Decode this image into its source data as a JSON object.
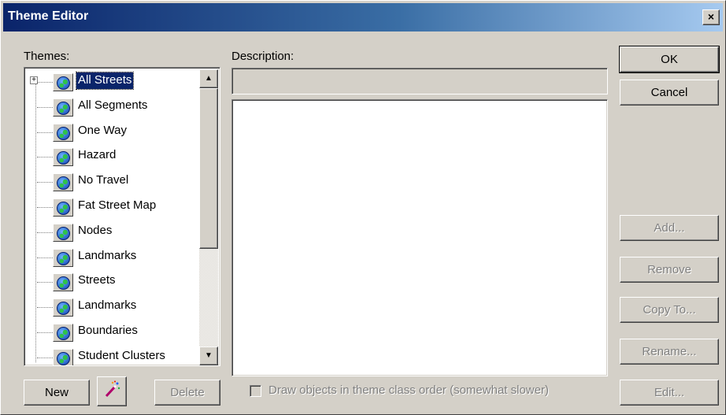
{
  "window": {
    "title": "Theme Editor",
    "close_glyph": "×"
  },
  "themes": {
    "label": "Themes:",
    "items": [
      {
        "label": "All Streets",
        "selected": true,
        "expandable": true
      },
      {
        "label": "All Segments"
      },
      {
        "label": "One Way"
      },
      {
        "label": "Hazard"
      },
      {
        "label": "No Travel"
      },
      {
        "label": "Fat Street Map"
      },
      {
        "label": "Nodes"
      },
      {
        "label": "Landmarks"
      },
      {
        "label": "Streets"
      },
      {
        "label": "Landmarks"
      },
      {
        "label": "Boundaries"
      },
      {
        "label": "Student Clusters"
      }
    ],
    "item_icon": "globe-icon"
  },
  "description": {
    "label": "Description:",
    "short_value": "",
    "text": ""
  },
  "buttons": {
    "ok": "OK",
    "cancel": "Cancel",
    "add": "Add...",
    "remove": "Remove",
    "copy_to": "Copy To...",
    "rename": "Rename...",
    "edit": "Edit...",
    "new": "New",
    "delete": "Delete"
  },
  "options": {
    "draw_in_order_label": "Draw objects in theme class order (somewhat slower)",
    "draw_in_order_checked": false
  },
  "colors": {
    "title_start": "#0a246a",
    "title_end": "#a6caf0",
    "selection": "#0a246a"
  }
}
